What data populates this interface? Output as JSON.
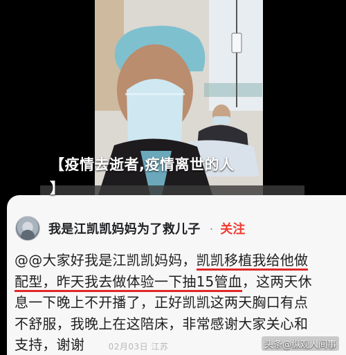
{
  "overlay": {
    "title_line1": "【疫情去逝者,疫情离世的人",
    "title_line2": "】"
  },
  "post": {
    "author": "我是江凯凯妈妈为了救儿子",
    "separator": "·",
    "follow_label": "关注",
    "body_lines": [
      {
        "before": "@@大家好我是江凯凯妈妈，",
        "highlight": "凯凯移植我给他做",
        "after": ""
      },
      {
        "before": "",
        "highlight": "配型，昨天我去做体验一下抽15管血",
        "after": "，这两天休"
      },
      {
        "before": "息一下晚上不开播了，正好凯凯这两天胸口有点",
        "highlight": "",
        "after": ""
      },
      {
        "before": "不舒服，我晚上在这陪床，非常感谢大家关心和",
        "highlight": "",
        "after": ""
      },
      {
        "before": "支持，谢谢",
        "highlight": "",
        "after": ""
      }
    ],
    "meta_text": "02月03日 江苏"
  },
  "watermark": "头条@纵观人间事",
  "colors": {
    "highlight_underline": "#e02727",
    "follow": "#ef3b2f",
    "overlay_text": "#ffffff"
  }
}
